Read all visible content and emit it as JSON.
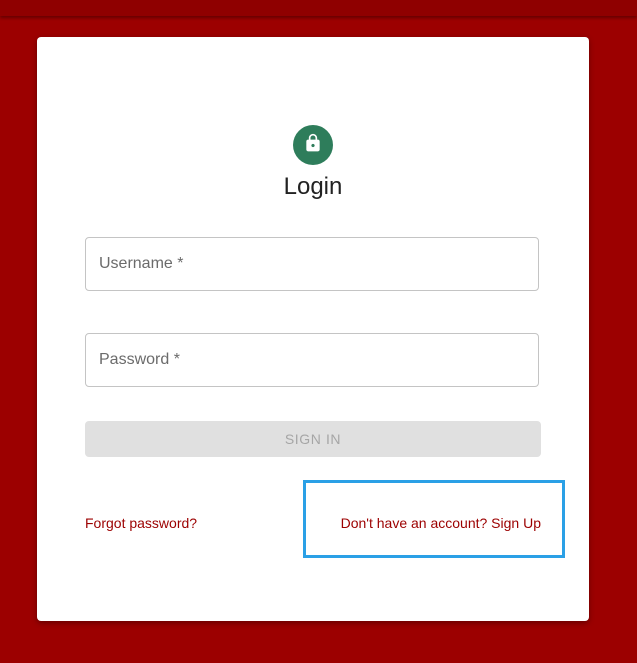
{
  "page": {
    "background_color": "#9c0000",
    "accent_color": "#2e7d5b",
    "link_color": "#9c0000",
    "highlight_color": "#2aa0e6"
  },
  "login": {
    "icon": "lock-icon",
    "title": "Login",
    "username_placeholder": "Username *",
    "password_placeholder": "Password *",
    "sign_in_label": "SIGN IN",
    "forgot_password_label": "Forgot password?",
    "sign_up_label": "Don't have an account? Sign Up"
  }
}
